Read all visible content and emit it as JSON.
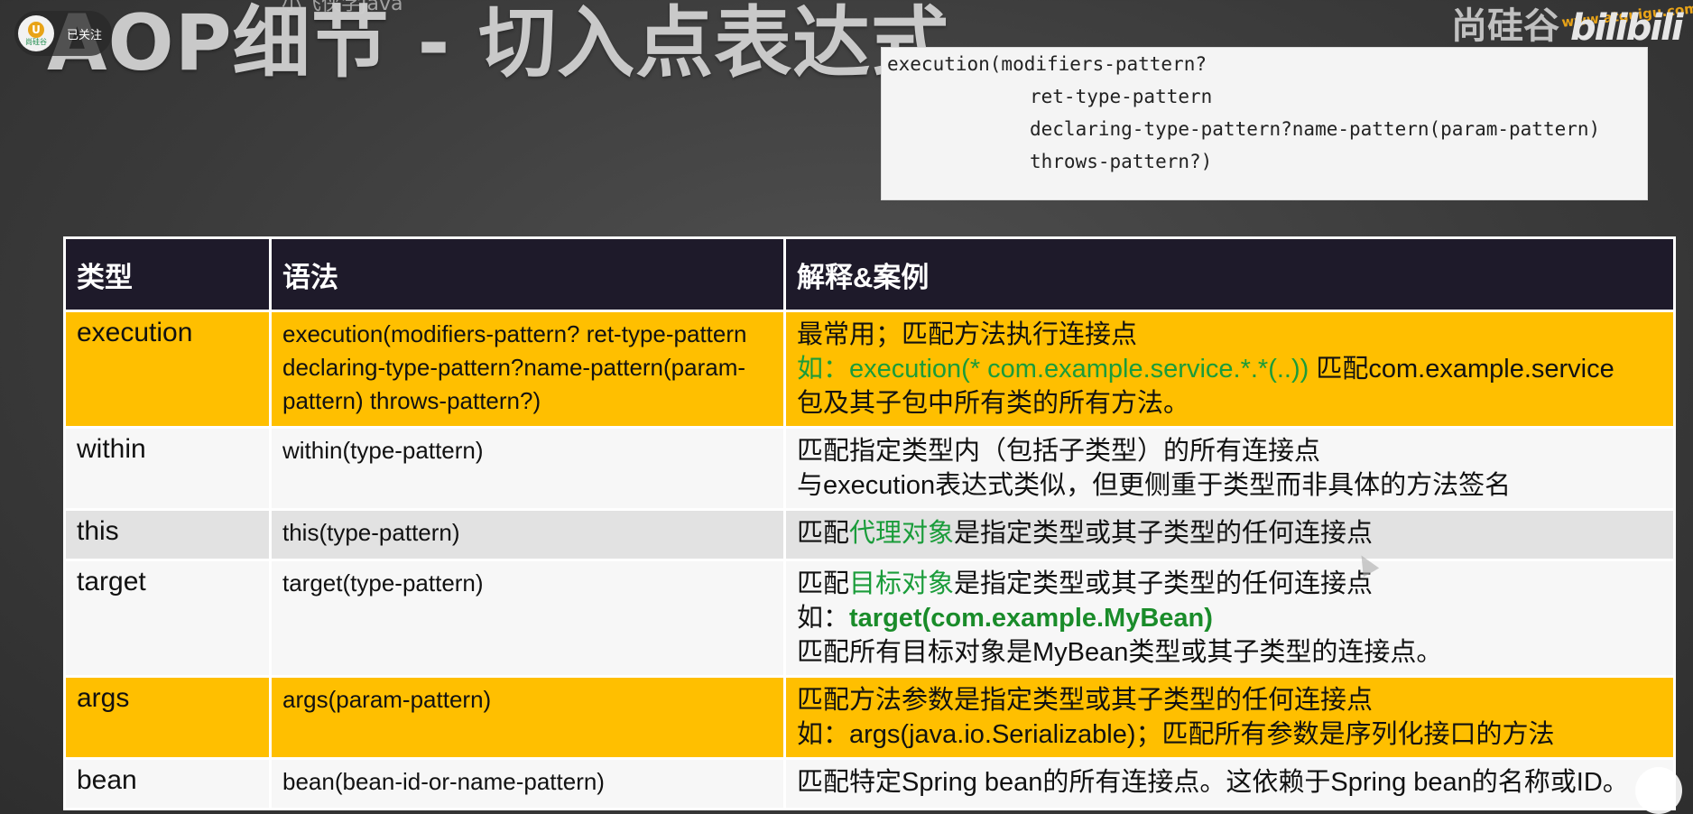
{
  "overlay": {
    "author": "小飞侠学Java",
    "follow_label": "已关注",
    "avatar_text": "尚硅谷",
    "brand": "尚硅谷",
    "brand_url": "www.atguigu.com",
    "platform": "bilibili"
  },
  "slide": {
    "title": "AOP细节 - 切入点表达式",
    "code_lines": [
      "execution(modifiers-pattern?",
      "ret-type-pattern",
      "declaring-type-pattern?name-pattern(param-pattern)",
      "throws-pattern?)"
    ],
    "headers": [
      "类型",
      "语法",
      "解释&案例"
    ],
    "rows": [
      {
        "type": "execution",
        "syntax": "execution(modifiers-pattern? ret-type-pattern declaring-type-pattern?name-pattern(param-pattern) throws-pattern?)",
        "desc1": "最常用；匹配方法执行连接点",
        "desc2_prefix": "如：",
        "desc2_code": "execution(* com.example.service.*.*(..))",
        "desc2_suffix": " 匹配com.example.service",
        "desc3": "包及其子包中所有类的所有方法。"
      },
      {
        "type": "within",
        "syntax": "within(type-pattern)",
        "desc1": "匹配指定类型内（包括子类型）的所有连接点",
        "desc2": "与execution表达式类似，但更侧重于类型而非具体的方法签名"
      },
      {
        "type": "this",
        "syntax": "this(type-pattern)",
        "desc_prefix": "匹配",
        "desc_highlight": "代理对象",
        "desc_suffix": "是指定类型或其子类型的任何连接点"
      },
      {
        "type": "target",
        "syntax": "target(type-pattern)",
        "desc_prefix": "匹配",
        "desc_highlight": "目标对象",
        "desc_suffix": "是指定类型或其子类型的任何连接点",
        "desc2_prefix": "如：",
        "desc2_code": "target(com.example.MyBean)",
        "desc3": "匹配所有目标对象是MyBean类型或其子类型的连接点。"
      },
      {
        "type": "args",
        "syntax": "args(param-pattern)",
        "desc1": "匹配方法参数是指定类型或其子类型的任何连接点",
        "desc2": "如：args(java.io.Serializable)；匹配所有参数是序列化接口的方法"
      },
      {
        "type": "bean",
        "syntax": "bean(bean-id-or-name-pattern)",
        "desc1": "匹配特定Spring bean的所有连接点。这依赖于Spring bean的名称或ID。"
      }
    ]
  }
}
